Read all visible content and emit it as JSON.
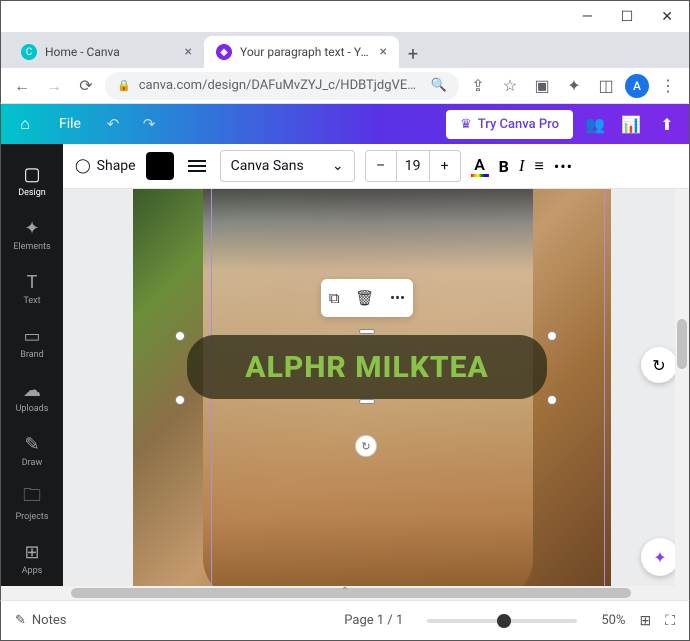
{
  "window": {
    "min": "—",
    "max": "☐",
    "close": "✕"
  },
  "tabs": {
    "items": [
      {
        "title": "Home - Canva",
        "favcolor": "#00c4cc"
      },
      {
        "title": "Your paragraph text - Your S",
        "favcolor": "#7d2ae8"
      }
    ]
  },
  "urlbar": {
    "url": "canva.com/design/DAFuMvZYJ_c/HDBTjdgVE…",
    "avatar": "A"
  },
  "header": {
    "file": "File",
    "try_pro": "Try Canva Pro"
  },
  "rail": {
    "items": [
      {
        "label": "Design",
        "icon": "▢"
      },
      {
        "label": "Elements",
        "icon": "✦"
      },
      {
        "label": "Text",
        "icon": "T"
      },
      {
        "label": "Brand",
        "icon": "▭"
      },
      {
        "label": "Uploads",
        "icon": "☁"
      },
      {
        "label": "Draw",
        "icon": "✎"
      },
      {
        "label": "Projects",
        "icon": "🗀"
      },
      {
        "label": "Apps",
        "icon": "⊞"
      }
    ]
  },
  "toolbar": {
    "shape": "Shape",
    "font": "Canva Sans",
    "size_minus": "–",
    "size": "19",
    "size_plus": "+",
    "color_letter": "A",
    "bold": "B",
    "italic": "I",
    "more": "•••"
  },
  "canvas": {
    "text": "ALPHR MILKTEA",
    "ctx": {
      "dup": "⧉",
      "del": "🗑",
      "more": "•••"
    },
    "rotate": "↻",
    "refresh": "↻",
    "magic": "✦"
  },
  "footer": {
    "notes": "Notes",
    "notes_icon": "✎",
    "page": "Page 1 / 1",
    "zoom": "50%",
    "grid": "⊞",
    "expand": "⛶"
  }
}
